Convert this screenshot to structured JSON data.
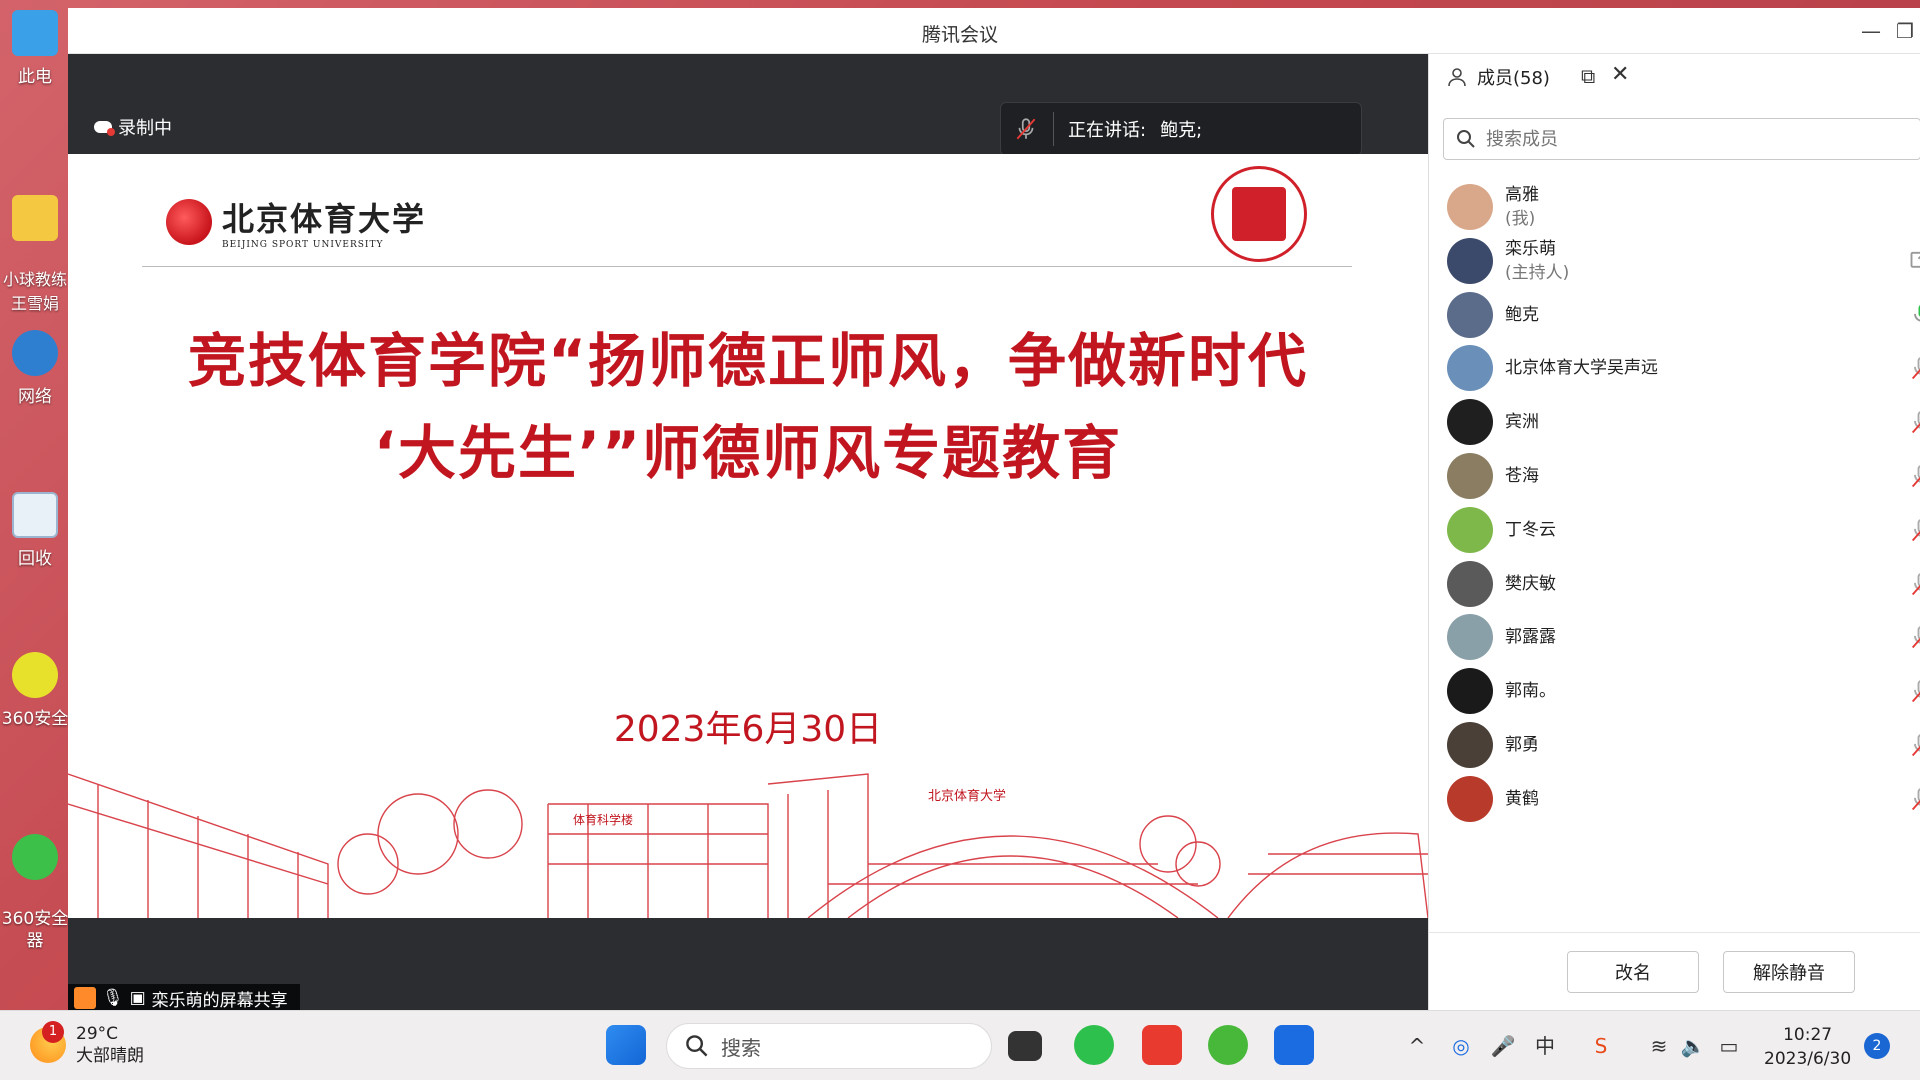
{
  "desktop": {
    "icons": [
      {
        "label": "此电"
      },
      {
        "label": "小球教练\n王雪娟"
      },
      {
        "label": "网络"
      },
      {
        "label": "回收"
      },
      {
        "label": "360安全"
      },
      {
        "label": "360安全\n器"
      }
    ]
  },
  "window": {
    "title": "腾讯会议",
    "minimize": "—",
    "restore": "❐"
  },
  "stage": {
    "recording_label": "录制中",
    "speaking_label": "正在讲话:",
    "speaking_name": "鲍克;",
    "share_tag": "栾乐萌的屏幕共享"
  },
  "slide": {
    "university_cn": "北京体育大学",
    "university_en": "BEIJING SPORT UNIVERSITY",
    "title_line1": "竞技体育学院“扬师德正师风，争做新时代",
    "title_line2": "‘大先生’”师德师风专题教育",
    "date": "2023年6月30日",
    "building_sign": "体育科学楼",
    "arch_sign": "北京体育大学"
  },
  "panel": {
    "title": "成员(58)",
    "search_placeholder": "搜索成员",
    "members": [
      {
        "name": "高雅",
        "role": "(我)",
        "color": "#d9a88a",
        "mic": "none"
      },
      {
        "name": "栾乐萌",
        "role": "(主持人)",
        "color": "#3b4a6b",
        "mic": "share"
      },
      {
        "name": "鲍克",
        "role": "",
        "color": "#5b6c8a",
        "mic": "on"
      },
      {
        "name": "北京体育大学吴声远",
        "role": "",
        "color": "#6a8fb8",
        "mic": "off"
      },
      {
        "name": "宾洲",
        "role": "",
        "color": "#1f1f1f",
        "mic": "off"
      },
      {
        "name": "苍海",
        "role": "",
        "color": "#8a7d62",
        "mic": "off"
      },
      {
        "name": "丁冬云",
        "role": "",
        "color": "#7fb84a",
        "mic": "off"
      },
      {
        "name": "樊庆敏",
        "role": "",
        "color": "#5a5a5a",
        "mic": "off"
      },
      {
        "name": "郭露露",
        "role": "",
        "color": "#8aa0a8",
        "mic": "off"
      },
      {
        "name": "郭南。",
        "role": "",
        "color": "#1a1a1a",
        "mic": "off"
      },
      {
        "name": "郭勇",
        "role": "",
        "color": "#4a4038",
        "mic": "off"
      },
      {
        "name": "黄鹤",
        "role": "",
        "color": "#b83a2a",
        "mic": "off"
      }
    ],
    "rename_button": "改名",
    "unmute_button": "解除静音"
  },
  "taskbar": {
    "weather_temp": "29°C",
    "weather_desc": "大部晴朗",
    "weather_badge": "1",
    "search_label": "搜索",
    "ime_label": "中",
    "time": "10:27",
    "date": "2023/6/30",
    "notifications": "2"
  }
}
